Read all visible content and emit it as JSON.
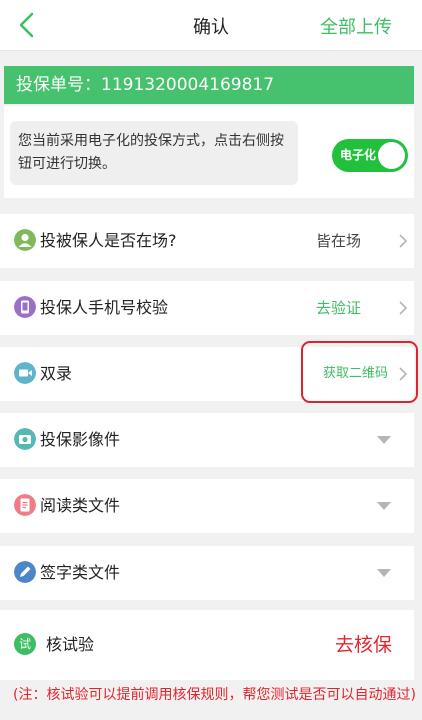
{
  "header": {
    "title": "确认",
    "upload_all": "全部上传",
    "back_icon": "chevron-left-icon"
  },
  "policy": {
    "label": "投保单号：",
    "number": "1191320004169817"
  },
  "electronic_mode": {
    "notice": "您当前采用电子化的投保方式，点击右侧按钮可进行切换。",
    "toggle_label": "电子化",
    "toggle_on": true
  },
  "rows": [
    {
      "label": "投被保人是否在场?",
      "value": "皆在场",
      "icon": "person-icon",
      "action": "chevron-right"
    },
    {
      "label": "投保人手机号校验",
      "value": "去验证",
      "icon": "phone-icon",
      "action": "chevron-right"
    },
    {
      "label": "双录",
      "value": "获取二维码",
      "icon": "video-icon",
      "action": "chevron-right"
    },
    {
      "label": "投保影像件",
      "value": "",
      "icon": "camera-icon",
      "action": "chevron-down"
    },
    {
      "label": "阅读类文件",
      "value": "",
      "icon": "document-icon",
      "action": "chevron-down"
    },
    {
      "label": "签字类文件",
      "value": "",
      "icon": "pen-icon",
      "action": "chevron-down"
    }
  ],
  "trial": {
    "icon_text": "试",
    "label": "核试验",
    "action": "去核保",
    "note": "(注：核试验可以提前调用核保规则，帮您测试是否可以自动通过)"
  },
  "colors": {
    "brand_green": "#46c16e",
    "toggle_green": "#22c13d",
    "alert_red": "#e3262d",
    "background": "#f1f1f1"
  }
}
